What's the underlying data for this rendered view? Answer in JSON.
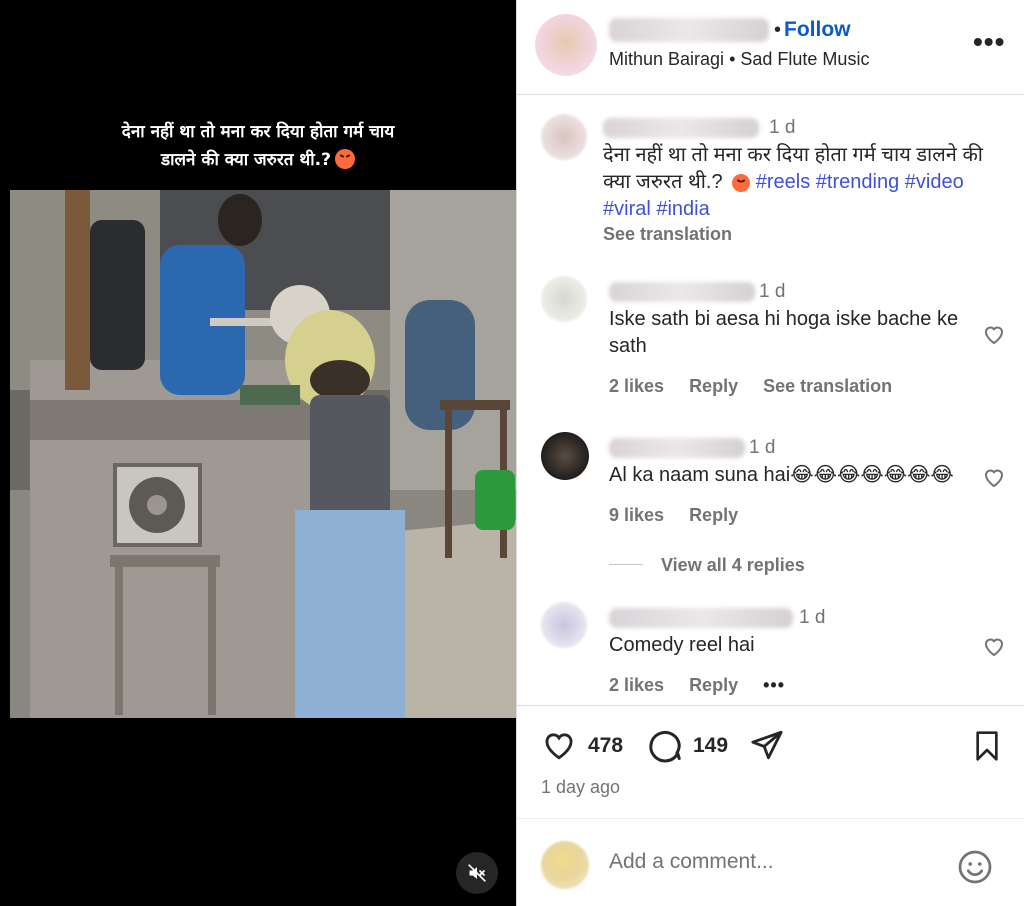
{
  "video": {
    "caption_line1": "देना नहीं था तो मना कर दिया होता गर्म चाय",
    "caption_line2": "डालने की क्या जरुरत थी.?",
    "mute_icon": "speaker-muted-icon"
  },
  "header": {
    "follow_label": "Follow",
    "audio_artist": "Mithun Bairagi",
    "audio_track": "Sad Flute Music",
    "more_label": "•••"
  },
  "post": {
    "time": "1 d",
    "caption": "देना नहीं था तो मना कर दिया होता गर्म चाय डालने की क्या जरुरत थी.?",
    "hashtags": [
      "#reels",
      "#trending",
      "#video",
      "#viral",
      "#india"
    ],
    "see_translation": "See translation"
  },
  "comments": [
    {
      "time": "1 d",
      "text": "Iske sath bi aesa hi hoga iske bache ke sath",
      "likes": "2 likes",
      "reply": "Reply",
      "translation": "See translation"
    },
    {
      "time": "1 d",
      "text": "Al ka naam suna hai😂😂😂😂😂😂😂",
      "likes": "9 likes",
      "reply": "Reply",
      "view_replies": "View all 4 replies"
    },
    {
      "time": "1 d",
      "text": "Comedy reel hai",
      "likes": "2 likes",
      "reply": "Reply",
      "more": "•••"
    }
  ],
  "actions": {
    "like_count": "478",
    "comment_count": "149",
    "posted_ago": "1 day ago"
  },
  "composer": {
    "placeholder": "Add a comment..."
  },
  "colors": {
    "link": "#0a5bc4",
    "hashtag": "#3f51d6",
    "muted": "#737373",
    "border": "#dbdbdb"
  }
}
